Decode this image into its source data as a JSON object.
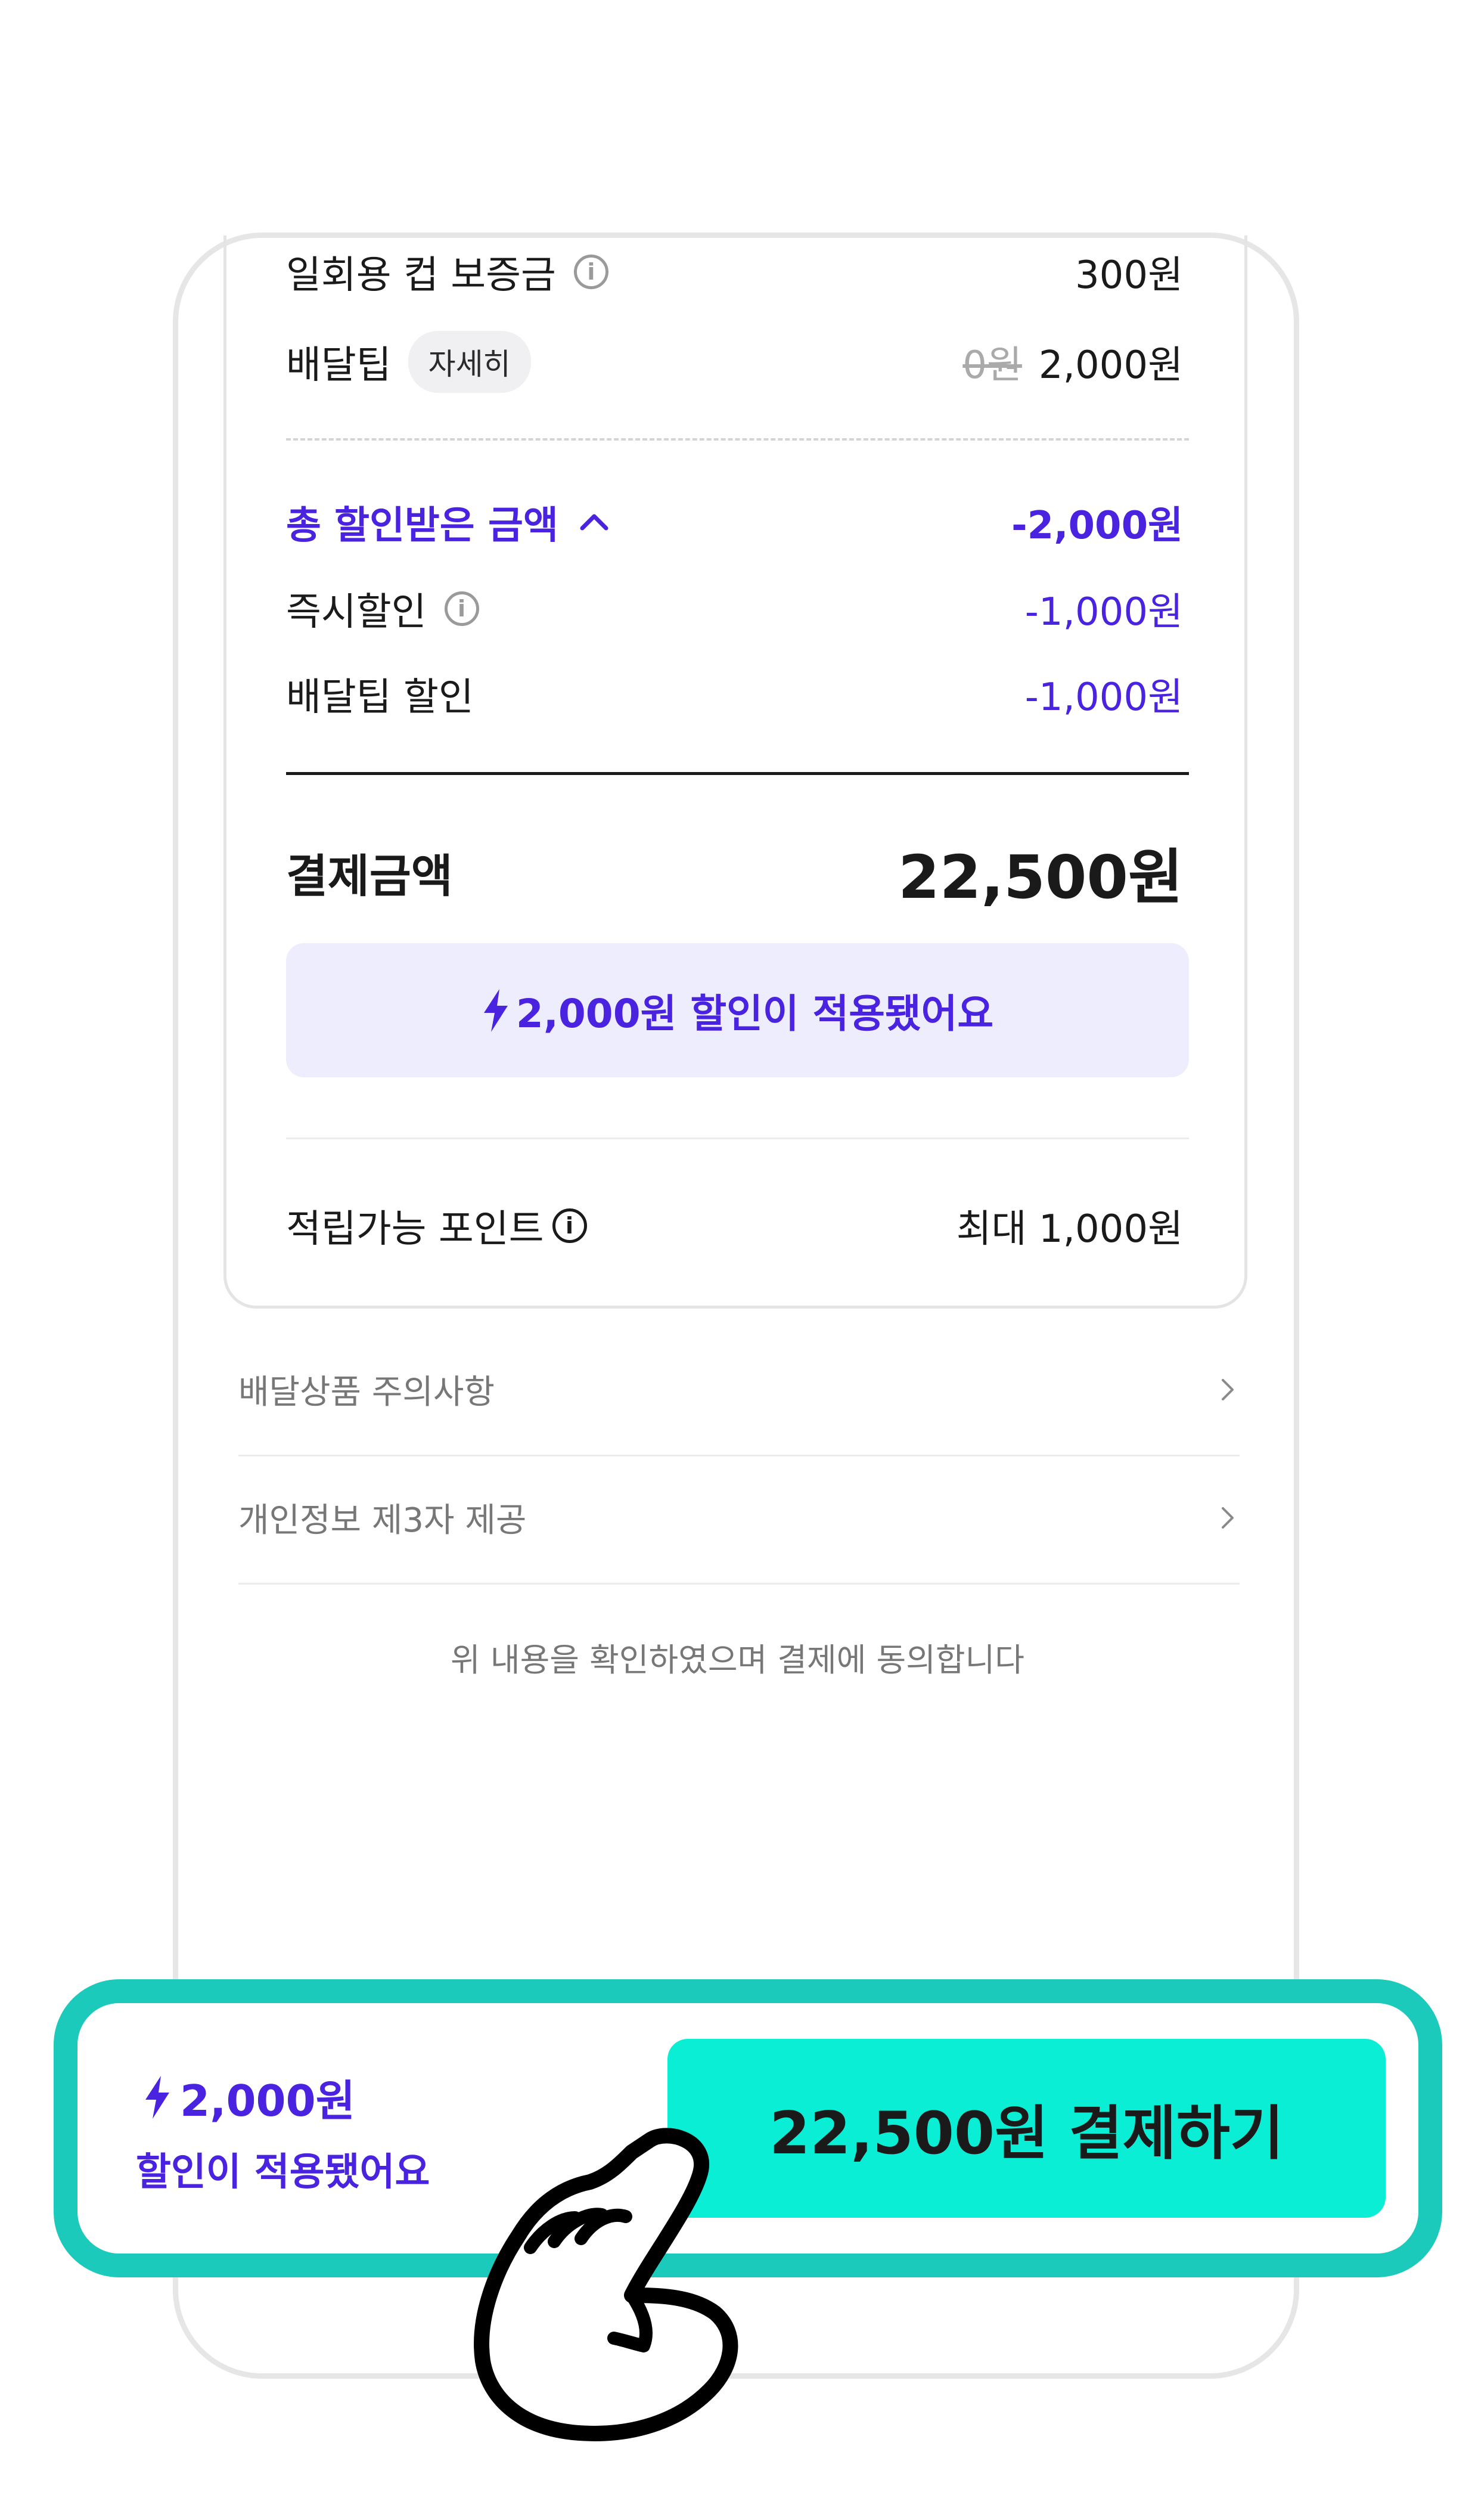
{
  "items": {
    "cup_deposit_label": "일회용 컵 보증금",
    "cup_deposit_value": "300원",
    "delivery_tip_label": "배달팁",
    "detail_pill": "자세히",
    "delivery_tip_old": "0원",
    "delivery_tip_value": "2,000원"
  },
  "discount": {
    "total_label": "총 할인받은 금액",
    "total_value": "-2,000원",
    "instant_label": "즉시할인",
    "instant_value": "-1,000원",
    "tip_discount_label": "배달팁 할인",
    "tip_discount_value": "-1,000원"
  },
  "payment": {
    "label": "결제금액",
    "value": "22,500원",
    "banner": "2,000원 할인이 적용됐어요"
  },
  "points": {
    "label": "적립가능 포인트",
    "value": "최대 1,000원"
  },
  "links": [
    {
      "label": "배달상품 주의사항"
    },
    {
      "label": "개인정보 제3자 제공"
    }
  ],
  "agreement_notice": "위 내용을 확인하였으며 결제에 동의합니다",
  "bottom_bar": {
    "discount_amount": "2,000원",
    "discount_text": "할인이 적용됐어요",
    "pay_button": "22,500원 결제하기"
  },
  "colors": {
    "accent_purple": "#4a23e0",
    "pay_button": "#0aeed5",
    "highlight_border": "#1ccabb",
    "banner_bg": "#ededfd"
  },
  "icons": [
    "info-icon",
    "chevron-up-icon",
    "lightning-icon",
    "chevron-right-icon",
    "hand-pointer-icon"
  ]
}
